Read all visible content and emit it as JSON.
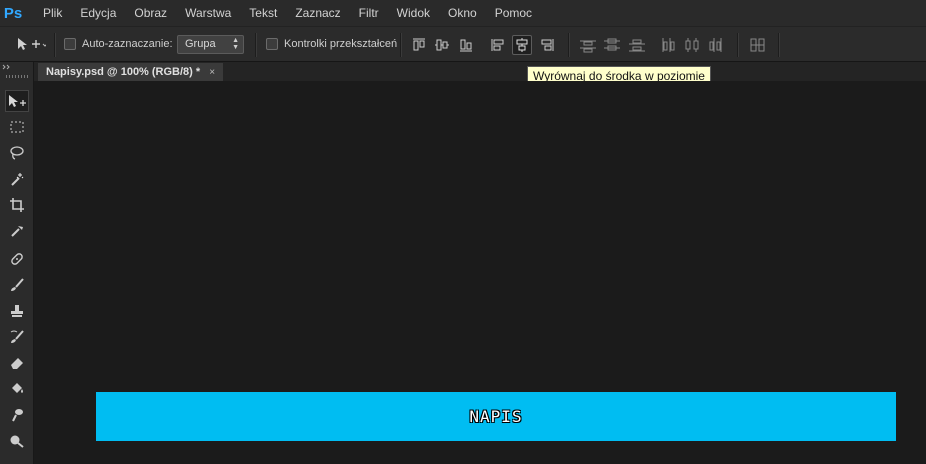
{
  "app": {
    "logo": "Ps"
  },
  "menu": [
    "Plik",
    "Edycja",
    "Obraz",
    "Warstwa",
    "Tekst",
    "Zaznacz",
    "Filtr",
    "Widok",
    "Okno",
    "Pomoc"
  ],
  "options": {
    "auto_select_label": "Auto-zaznaczanie:",
    "auto_select_value": "Grupa",
    "transform_controls_label": "Kontrolki przekształceń"
  },
  "tooltip": "Wyrównaj do środka w poziomie",
  "document_tab": {
    "title": "Napisy.psd @ 100% (RGB/8) *",
    "close": "×"
  },
  "canvas": {
    "banner_text": "NAPIS",
    "banner_color": "#00bdf2"
  },
  "tools": [
    "move-tool-icon",
    "rectangular-marquee-icon",
    "lasso-icon",
    "magic-wand-icon",
    "crop-icon",
    "eyedropper-icon",
    "healing-brush-icon",
    "brush-icon",
    "clone-stamp-icon",
    "history-brush-icon",
    "eraser-icon",
    "paint-bucket-icon",
    "smudge-icon",
    "dodge-icon"
  ]
}
